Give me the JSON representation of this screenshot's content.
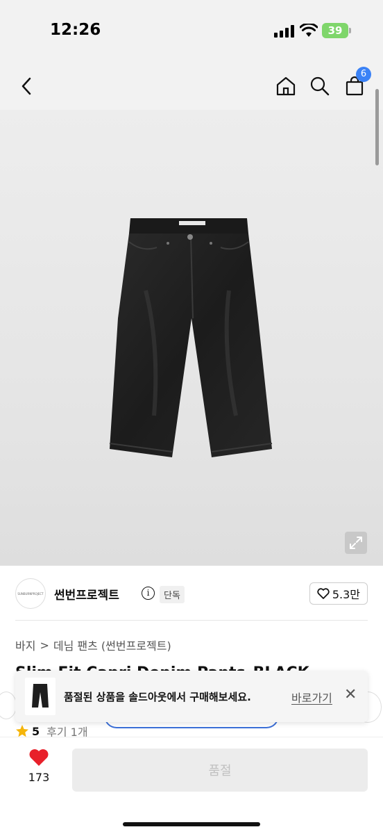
{
  "status_bar": {
    "time": "12:26",
    "battery": "39"
  },
  "nav": {
    "cart_count": "6"
  },
  "seller": {
    "logo_text": "SUNBURNPROJECT",
    "name": "썬번프로젝트",
    "info_symbol": "i",
    "badge": "단독",
    "like_count": "5.3만"
  },
  "breadcrumb": {
    "items": [
      "바지",
      "데님 팬츠 (썬번프로젝트)"
    ],
    "separator": ">"
  },
  "product": {
    "title": "Slim Fit Capri Denim Pants_BLACK"
  },
  "toast": {
    "message": "품절된 상품을 솔드아웃에서 구매해보세요.",
    "link_label": "바로가기",
    "close_symbol": "✕"
  },
  "rating": {
    "score": "5",
    "review_label": "후기 1개"
  },
  "bottom": {
    "wish_count": "173",
    "soldout_label": "품절"
  },
  "colors": {
    "accent_blue": "#3b82f6",
    "heart_red": "#e8202a",
    "battery_green": "#7fd66b"
  }
}
